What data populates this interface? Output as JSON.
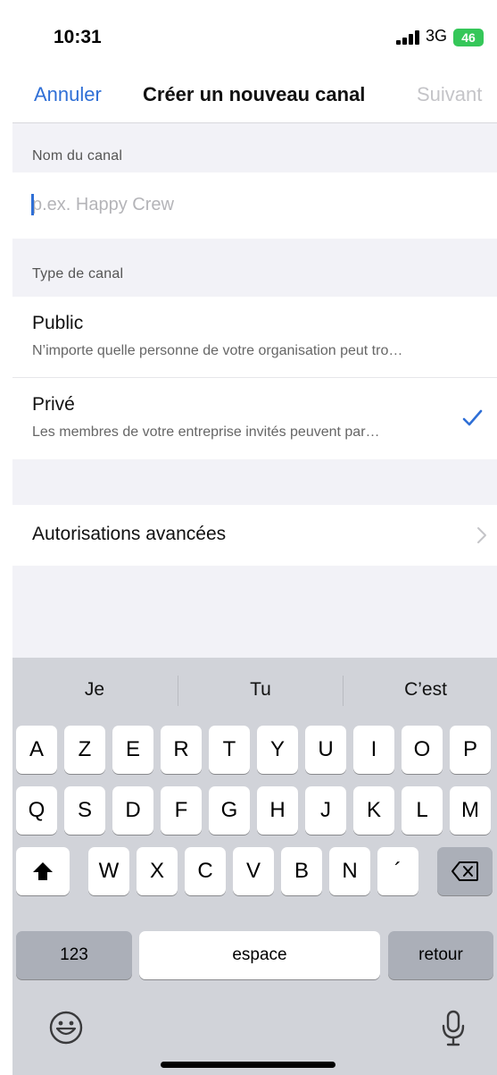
{
  "status_bar": {
    "time": "10:31",
    "network": "3G",
    "battery": "46"
  },
  "nav": {
    "cancel": "Annuler",
    "title": "Créer un nouveau canal",
    "next": "Suivant"
  },
  "channel_name": {
    "label": "Nom du canal",
    "placeholder": "p.ex. Happy Crew",
    "value": ""
  },
  "channel_type": {
    "label": "Type de canal",
    "options": [
      {
        "title": "Public",
        "description": "N’importe quelle personne de votre organisation peut tro…",
        "selected": false
      },
      {
        "title": "Privé",
        "description": "Les membres de votre entreprise invités peuvent par…",
        "selected": true
      }
    ]
  },
  "advanced": {
    "label": "Autorisations avancées"
  },
  "keyboard": {
    "suggestions": [
      "Je",
      "Tu",
      "C’est"
    ],
    "row1": [
      "A",
      "Z",
      "E",
      "R",
      "T",
      "Y",
      "U",
      "I",
      "O",
      "P"
    ],
    "row2": [
      "Q",
      "S",
      "D",
      "F",
      "G",
      "H",
      "J",
      "K",
      "L",
      "M"
    ],
    "row3": [
      "W",
      "X",
      "C",
      "V",
      "B",
      "N",
      "´"
    ],
    "numbers_key": "123",
    "space_key": "espace",
    "return_key": "retour"
  },
  "colors": {
    "accent": "#2f6fd6",
    "battery": "#35c759",
    "keyboard_bg": "#d1d3d9"
  }
}
